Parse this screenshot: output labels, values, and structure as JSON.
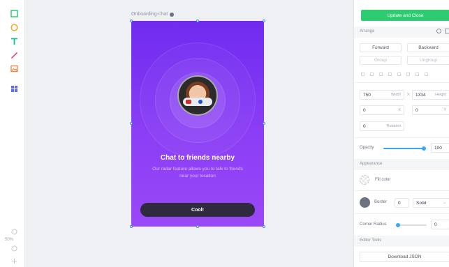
{
  "toolbar": {
    "tools": [
      {
        "name": "rectangle-tool",
        "color": "#2ecc71"
      },
      {
        "name": "ellipse-tool",
        "color": "#f5a623"
      },
      {
        "name": "text-tool",
        "color": "#1abc9c"
      },
      {
        "name": "line-tool",
        "color": "#e84a7a"
      },
      {
        "name": "image-tool",
        "color": "#f0803c"
      },
      {
        "name": "components-tool",
        "color": "#5b6cf0"
      }
    ],
    "zoom": "50%"
  },
  "canvas": {
    "artboard_label": "Onboarding-chat",
    "screen": {
      "headline": "Chat to friends nearby",
      "body": "Our radar feature allows you to talk to friends near your location",
      "cta_label": "Cool!"
    }
  },
  "panel": {
    "primary_action": "Update and Close",
    "arrange": {
      "title": "Arrange",
      "forward": "Forward",
      "backward": "Backward",
      "group": "Group",
      "ungroup": "Ungroup"
    },
    "size": {
      "width_value": "750",
      "width_label": "Width",
      "height_value": "1334",
      "height_label": "Height"
    },
    "position": {
      "x_value": "0",
      "x_label": "X",
      "y_value": "0",
      "y_label": "Y",
      "rotation_value": "0",
      "rotation_label": "Rotation"
    },
    "opacity": {
      "label": "Opacity",
      "value": "100",
      "level": 1.0
    },
    "appearance": {
      "title": "Appearance",
      "fill_label": "Fill color",
      "border_label": "Border",
      "border_value": "0",
      "border_style": "Solid",
      "border_color": "#6b7280",
      "corner_label": "Corner Radius",
      "corner_value": "0",
      "corner_level": 0.0
    },
    "editor_tools": {
      "title": "Editor Tools",
      "download": "Download JSON"
    }
  }
}
